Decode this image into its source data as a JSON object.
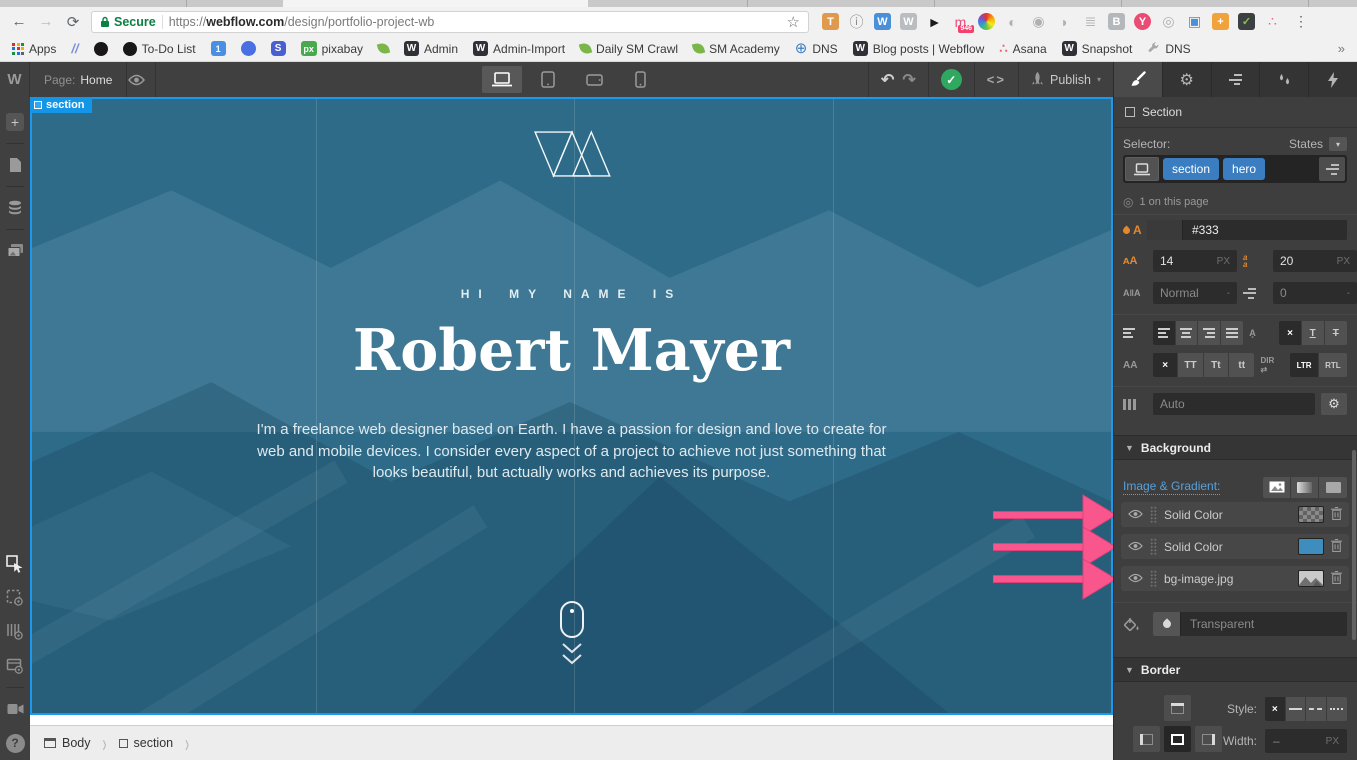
{
  "colors": {
    "accent_blue": "#1496e8",
    "tag_blue": "#3a7dc0",
    "pink_arrow": "#f9568d",
    "canvas_teal": "#2e6b88",
    "orange_icon": "#e2882f",
    "link_blue": "#57a0d9",
    "secure_green": "#0b8043",
    "layer_blue_swatch": "#3f8dbd"
  },
  "browser": {
    "secure_label": "Secure",
    "url_scheme": "https://",
    "url_host": "webflow.com",
    "url_path": "/design/portfolio-project-wb",
    "bookmarks_overflow": "»",
    "bookmarks": [
      {
        "label": "Apps",
        "icon": "apps-grid"
      },
      {
        "label": "",
        "icon": "slashes"
      },
      {
        "label": "",
        "icon": "github"
      },
      {
        "label": "To-Do List",
        "icon": "github"
      },
      {
        "label": "",
        "icon": "calendar-blue"
      },
      {
        "label": "",
        "icon": "chat-blue"
      },
      {
        "label": "",
        "icon": "skype-s"
      },
      {
        "label": "pixabay",
        "icon": "pixabay-px"
      },
      {
        "label": "",
        "icon": "sprout"
      },
      {
        "label": "Admin",
        "icon": "webflow-w"
      },
      {
        "label": "Admin-Import",
        "icon": "webflow-w"
      },
      {
        "label": "Daily SM Crawl",
        "icon": "sprout"
      },
      {
        "label": "SM Academy",
        "icon": "sprout"
      },
      {
        "label": "DNS",
        "icon": "globe"
      },
      {
        "label": "Blog posts | Webflow",
        "icon": "webflow-w"
      },
      {
        "label": "Asana",
        "icon": "asana-dots"
      },
      {
        "label": "Snapshot",
        "icon": "webflow-w"
      },
      {
        "label": "DNS",
        "icon": "wrench"
      }
    ],
    "extensions": [
      {
        "name": "hammer-extension-icon",
        "glyph": "T",
        "fg": "#fff",
        "bg": "#e09a4e",
        "shape": "square"
      },
      {
        "name": "info-extension-icon",
        "glyph": "ⓘ",
        "fg": "#8a8a8a",
        "bg": "",
        "shape": "plain"
      },
      {
        "name": "webflow-blue-extension-icon",
        "glyph": "W",
        "fg": "#fff",
        "bg": "#4a90d9",
        "shape": "square"
      },
      {
        "name": "webflow-gray-extension-icon",
        "glyph": "W",
        "fg": "#fff",
        "bg": "#b9bdc1",
        "shape": "square"
      },
      {
        "name": "pointer-extension-icon",
        "glyph": "►",
        "fg": "#1a1a1a",
        "bg": "",
        "shape": "plain"
      },
      {
        "name": "badge-946-extension-icon",
        "glyph": "m",
        "fg": "#ef4a7d",
        "bg": "",
        "shape": "plain",
        "badge": "946"
      },
      {
        "name": "color-wheel-extension-icon",
        "glyph": "",
        "fg": "",
        "bg": "",
        "shape": "wheel"
      },
      {
        "name": "circle-extension-icon",
        "glyph": "◐",
        "fg": "#b0b0b0",
        "bg": "",
        "shape": "plain"
      },
      {
        "name": "dot-circle-extension-icon",
        "glyph": "◉",
        "fg": "#b0b0b0",
        "bg": "",
        "shape": "plain"
      },
      {
        "name": "chat-extension-icon",
        "glyph": "◗",
        "fg": "#b0b0b0",
        "bg": "",
        "shape": "plain"
      },
      {
        "name": "notes-extension-icon",
        "glyph": "≣",
        "fg": "#b5b5b5",
        "bg": "",
        "shape": "plain"
      },
      {
        "name": "b-extension-icon",
        "glyph": "B",
        "fg": "#fff",
        "bg": "#b5b8bb",
        "shape": "square"
      },
      {
        "name": "y-extension-icon",
        "glyph": "Y",
        "fg": "#fff",
        "bg": "#ea4c74",
        "shape": "round"
      },
      {
        "name": "target-extension-icon",
        "glyph": "◎",
        "fg": "#b0b0b0",
        "bg": "",
        "shape": "plain"
      },
      {
        "name": "card-extension-icon",
        "glyph": "▣",
        "fg": "#4a90d9",
        "bg": "",
        "shape": "plain"
      },
      {
        "name": "plus-extension-icon",
        "glyph": "+",
        "fg": "#fff",
        "bg": "#f0a23c",
        "shape": "square"
      },
      {
        "name": "check-extension-icon",
        "glyph": "✓",
        "fg": "#8bc34a",
        "bg": "#3c4043",
        "shape": "square"
      },
      {
        "name": "asana-extension-icon",
        "glyph": "∴",
        "fg": "#ea6276",
        "bg": "",
        "shape": "plain"
      }
    ]
  },
  "designer": {
    "logo": "W",
    "page_label": "Page:",
    "page_name": "Home",
    "publish_label": "Publish"
  },
  "canvas": {
    "section_badge": "section",
    "eyebrow": "HI MY NAME IS",
    "title": "Robert Mayer",
    "paragraph": "I'm a freelance web designer based on Earth. I have a passion for design and love to create for web and mobile devices. I consider every aspect of a project to achieve not just something that looks beautiful, but actually works and achieves its purpose."
  },
  "breadcrumb": {
    "items": [
      "Body",
      "section"
    ]
  },
  "panel": {
    "element_title": "Section",
    "selector_label": "Selector:",
    "states_label": "States",
    "tags": [
      "section",
      "hero"
    ],
    "usage_text": "1 on this page",
    "typo": {
      "color": "#333",
      "size": "14",
      "size_unit": "PX",
      "line_height": "20",
      "lh_unit": "PX",
      "spacing": "Normal",
      "spacing_suffix": "-",
      "indent": "0",
      "indent_suffix": "-",
      "decoration_buttons": [
        "×",
        "T",
        "T"
      ],
      "case_buttons": [
        "×",
        "TT",
        "Tt",
        "tt"
      ],
      "dir_buttons": [
        "LTR",
        "RTL"
      ],
      "columns": "Auto"
    },
    "background": {
      "title": "Background",
      "link_label": "Image & Gradient:",
      "layers": [
        {
          "label": "Solid Color",
          "swatch": "checker"
        },
        {
          "label": "Solid Color",
          "swatch": "solid",
          "color": "#3f8dbd"
        },
        {
          "label": "bg-image.jpg",
          "swatch": "image"
        }
      ],
      "color_placeholder": "Transparent"
    },
    "border": {
      "title": "Border",
      "style_label": "Style:",
      "width_label": "Width:",
      "width_value": "–",
      "width_unit": "PX",
      "style_buttons": [
        "×",
        "solid",
        "dashed",
        "dotted"
      ]
    }
  }
}
